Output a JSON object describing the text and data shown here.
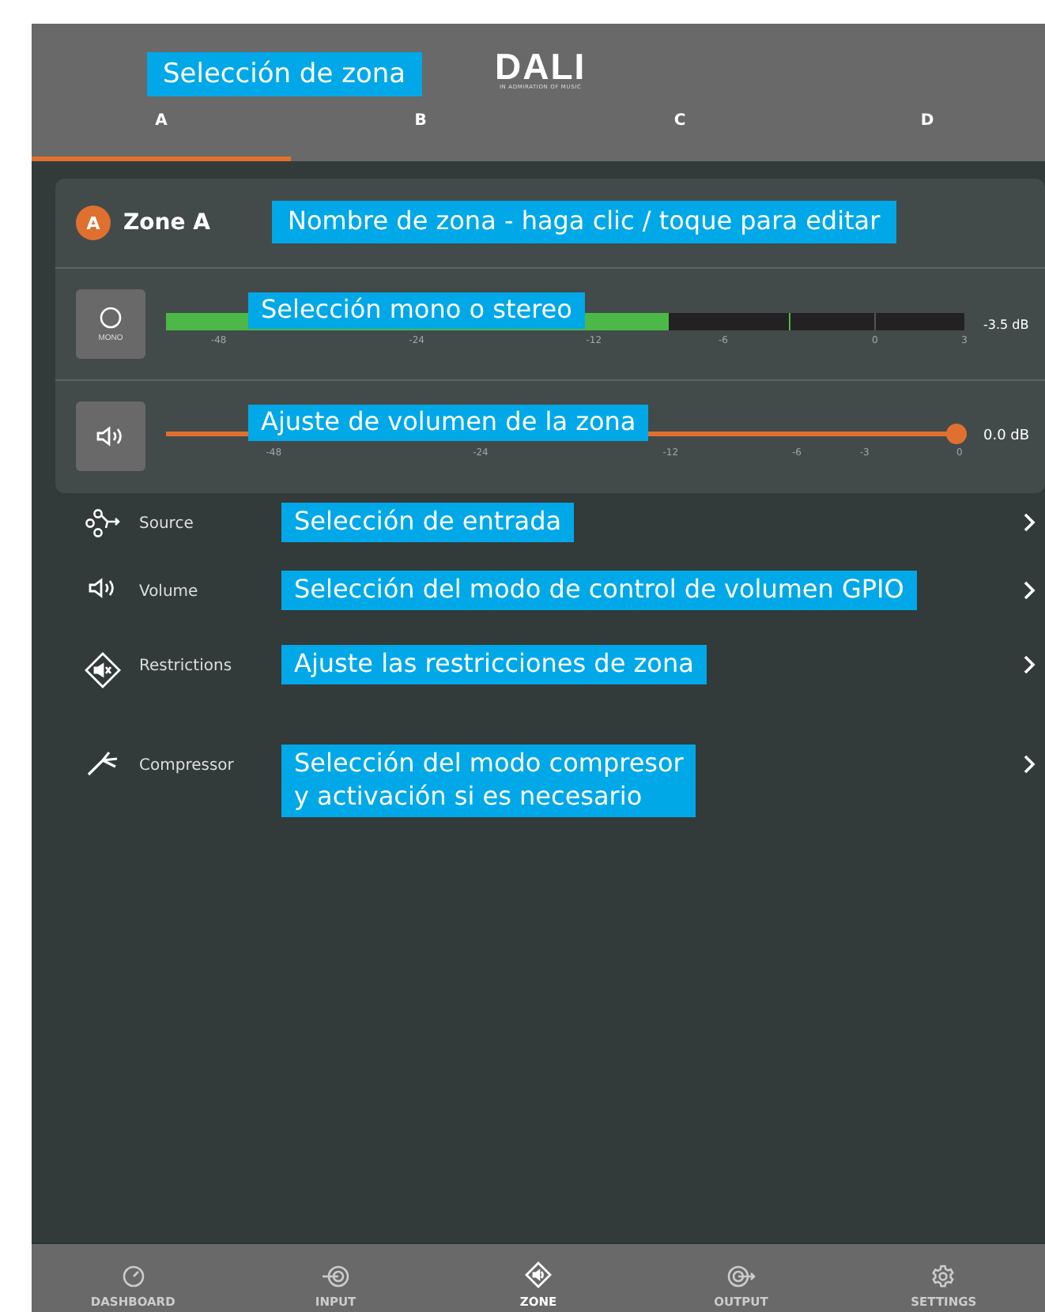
{
  "header": {
    "callout": "Selección de zona",
    "logo": {
      "brand": "DALI",
      "tagline": "IN ADMIRATION OF MUSIC"
    },
    "tabs": [
      {
        "label": "A",
        "selected": true
      },
      {
        "label": "B",
        "selected": false
      },
      {
        "label": "C",
        "selected": false
      },
      {
        "label": "D",
        "selected": false
      }
    ]
  },
  "zone": {
    "badge": "A",
    "name": "Zone A",
    "callout": "Nombre de zona - haga clic / toque para editar",
    "meter": {
      "button_label": "MONO",
      "level": 0.63,
      "reading": "-3.5 dB",
      "ticks": [
        "-48",
        "-24",
        "-12",
        "-6",
        "0",
        "3"
      ],
      "callout": "Selección mono o stereo"
    },
    "volume": {
      "level": 0.99,
      "reading": "0.0 dB",
      "ticks": [
        "-48",
        "-24",
        "-12",
        "-6",
        "-3",
        "0"
      ],
      "callout": "Ajuste de volumen de la zona"
    }
  },
  "menu": [
    {
      "kind": "source",
      "label": "Source",
      "callout": "Selección de entrada"
    },
    {
      "kind": "volume",
      "label": "Volume",
      "callout": "Selección del modo de control de volumen GPIO"
    },
    {
      "kind": "restrictions",
      "label": "Restrictions",
      "callout": "Ajuste las restricciones de zona"
    },
    {
      "kind": "compressor",
      "label": "Compressor",
      "callout": "Selección del modo compresor\ny activación si es necesario"
    }
  ],
  "nav": [
    {
      "kind": "dashboard",
      "label": "DASHBOARD",
      "selected": false
    },
    {
      "kind": "input",
      "label": "INPUT",
      "selected": false
    },
    {
      "kind": "zone",
      "label": "ZONE",
      "selected": true
    },
    {
      "kind": "output",
      "label": "OUTPUT",
      "selected": false
    },
    {
      "kind": "settings",
      "label": "SETTINGS",
      "selected": false
    }
  ]
}
